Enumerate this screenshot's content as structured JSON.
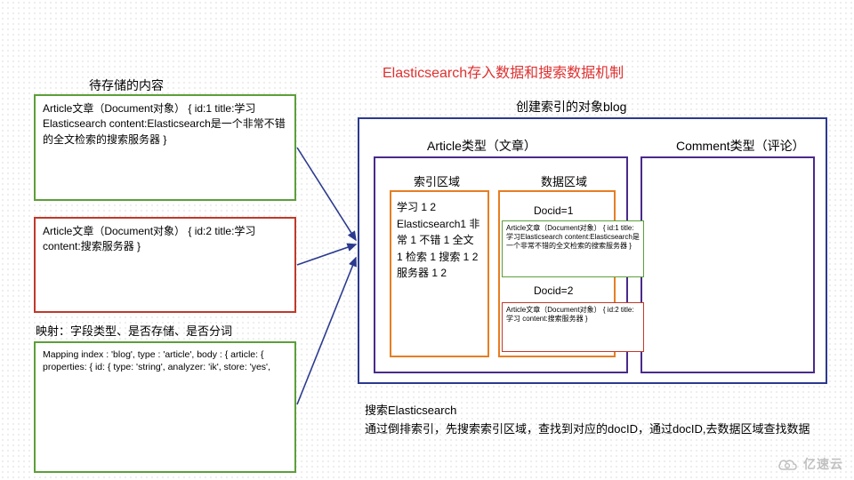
{
  "titles": {
    "left": "待存储的内容",
    "main": "Elasticsearch存入数据和搜索数据机制",
    "mapping": "映射：字段类型、是否存储、是否分词",
    "blog": "创建索引的对象blog",
    "article_type": "Article类型（文章）",
    "comment_type": "Comment类型（评论）",
    "index_area": "索引区域",
    "data_area": "数据区域",
    "docid1": "Docid=1",
    "docid2": "Docid=2"
  },
  "doc1": "Article文章（Document对象）\n{\n   id:1\n   title:学习Elasticsearch\n   content:Elasticsearch是一个非常不错的全文检索的搜索服务器\n}",
  "doc2": "Article文章（Document对象）\n{\n   id:2\n   title:学习\n   content:搜索服务器\n}",
  "mapping": "Mapping\n  index : 'blog',\n  type : 'article',\n  body : {\n     article: {\n       properties: {\n         id: {\n           type: 'string',\n           analyzer: 'ik',\n           store: 'yes',",
  "index_entries": "学习 1 2\nElasticsearch1\n非常 1\n不错 1\n全文 1\n检索 1\n搜索 1 2\n服务器 1 2",
  "mini1": "Article文章（Document对象）\n{\n  id:1\n  title:学习Elasticsearch\n  content:Elasticsearch是一个非常不错的全文检索的搜索服务器\n}",
  "mini2": "Article文章（Document对象）\n{\n  id:2\n  title:学习\n  content:搜索服务器\n}",
  "search": "搜索Elasticsearch\n通过倒排索引，先搜索索引区域，查找到对应的docID，通过docID,去数据区域查找数据",
  "watermark": "亿速云"
}
